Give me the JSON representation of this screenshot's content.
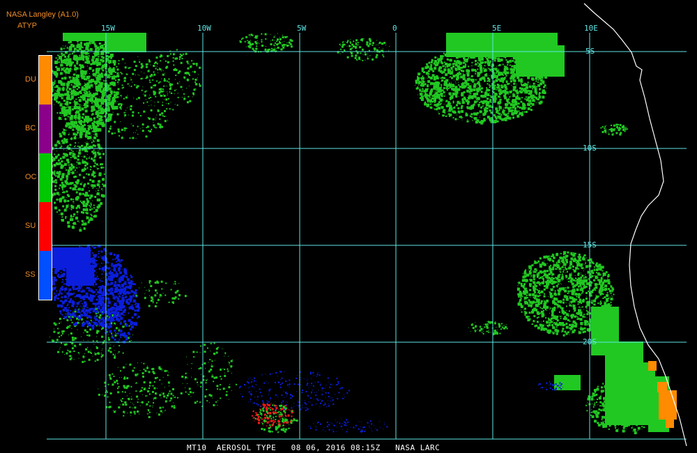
{
  "header": {
    "source": "NASA Langley (A1.0)",
    "product": "ATYP"
  },
  "legend": [
    {
      "code": "DU",
      "color": "#ff8c00"
    },
    {
      "code": "BC",
      "color": "#8b008b"
    },
    {
      "code": "OC",
      "color": "#00c800"
    },
    {
      "code": "SU",
      "color": "#ff0000"
    },
    {
      "code": "SS",
      "color": "#0050ff"
    }
  ],
  "footer": "MT10  AEROSOL TYPE   08 06, 2016 08:15Z   NASA LARC",
  "longitudes": [
    "15W",
    "10W",
    "5W",
    "0",
    "5E",
    "10E"
  ],
  "latitudes": [
    "5S",
    "10S",
    "15S",
    "20S"
  ],
  "colors": {
    "grid": "#5fe6e6",
    "coast": "#ffffff",
    "background": "#000000"
  }
}
